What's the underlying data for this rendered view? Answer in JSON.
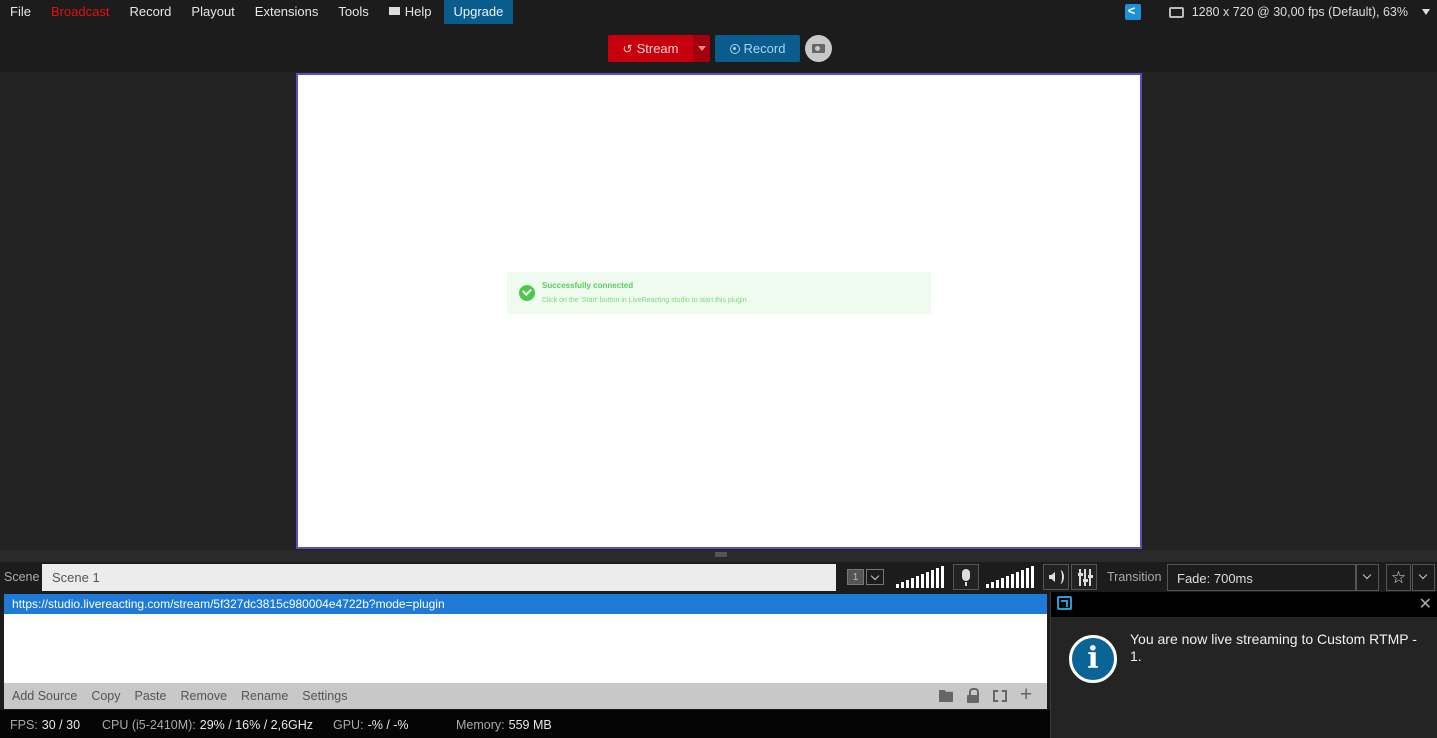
{
  "menu": {
    "items": [
      {
        "label": "File",
        "active": false
      },
      {
        "label": "Broadcast",
        "active": true
      },
      {
        "label": "Record",
        "active": false
      },
      {
        "label": "Playout",
        "active": false
      },
      {
        "label": "Extensions",
        "active": false
      },
      {
        "label": "Tools",
        "active": false
      },
      {
        "label": "Help",
        "active": false
      }
    ],
    "upgrade_label": "Upgrade",
    "resolution": "1280 x 720 @ 30,00 fps (Default), 63%"
  },
  "toolbar": {
    "stream_label": "Stream",
    "record_label": "Record"
  },
  "preview": {
    "notice_title": "Successfully connected",
    "notice_text": "Click on the 'Start' button in LiveReacting studio to start this plugin"
  },
  "scene": {
    "label": "Scene",
    "name": "Scene 1",
    "number": "1",
    "transition_label": "Transition",
    "transition_value": "Fade: 700ms"
  },
  "sources": {
    "items": [
      "https://studio.livereacting.com/stream/5f327dc3815c980004e4722b?mode=plugin"
    ],
    "toolbar": [
      "Add Source",
      "Copy",
      "Paste",
      "Remove",
      "Rename",
      "Settings"
    ]
  },
  "status": {
    "fps_label": "FPS:",
    "fps": "30 / 30",
    "cpu_label": "CPU (i5-2410M):",
    "cpu": "29% / 16% / 2,6GHz",
    "gpu_label": "GPU:",
    "gpu": "-% / -%",
    "memory_label": "Memory:",
    "memory": "559 MB"
  },
  "notification": {
    "message": "You are now live streaming to Custom RTMP - 1."
  },
  "colors": {
    "broadcast_active": "#e01010",
    "stream": "#c8000e",
    "record": "#0a5c8c",
    "selection": "#1e7ad6"
  }
}
